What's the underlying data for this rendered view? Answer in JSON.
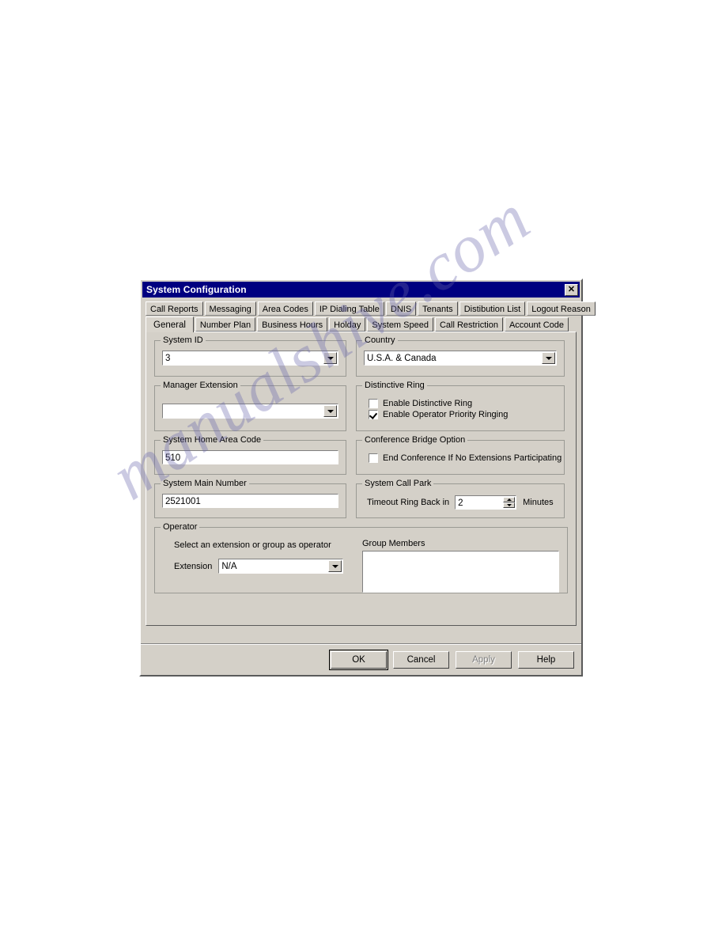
{
  "watermark": {
    "text": "manualshive.com"
  },
  "window": {
    "title": "System Configuration",
    "close_label": "✕"
  },
  "tabs": {
    "row1": [
      {
        "label": "Call Reports",
        "active": false
      },
      {
        "label": "Messaging",
        "active": false
      },
      {
        "label": "Area Codes",
        "active": false
      },
      {
        "label": "IP Dialing Table",
        "active": false
      },
      {
        "label": "DNIS",
        "active": false
      },
      {
        "label": "Tenants",
        "active": false
      },
      {
        "label": "Distibution List",
        "active": false
      },
      {
        "label": "Logout Reason",
        "active": false
      }
    ],
    "row2": [
      {
        "label": "General",
        "active": true
      },
      {
        "label": "Number Plan",
        "active": false
      },
      {
        "label": "Business Hours",
        "active": false
      },
      {
        "label": "Holday",
        "active": false
      },
      {
        "label": "System Speed",
        "active": false
      },
      {
        "label": "Call Restriction",
        "active": false
      },
      {
        "label": "Account Code",
        "active": false
      }
    ]
  },
  "form": {
    "system_id": {
      "legend": "System ID",
      "value": "3"
    },
    "manager_extension": {
      "legend": "Manager Extension",
      "value": ""
    },
    "system_home_area_code": {
      "legend": "System Home Area Code",
      "value": "510"
    },
    "system_main_number": {
      "legend": "System Main Number",
      "value": "2521001"
    },
    "country": {
      "legend": "Country",
      "value": "U.S.A. & Canada"
    },
    "distinctive_ring": {
      "legend": "Distinctive Ring",
      "items": [
        {
          "label": "Enable Distinctive Ring",
          "checked": false
        },
        {
          "label": "Enable Operator Priority Ringing",
          "checked": true
        }
      ]
    },
    "conference_bridge": {
      "legend": "Conference Bridge Option",
      "items": [
        {
          "label": "End Conference If No Extensions Participating",
          "checked": false
        }
      ]
    },
    "system_call_park": {
      "legend": "System Call Park",
      "timeout_label": "Timeout Ring Back in",
      "timeout_value": "2",
      "units_label": "Minutes"
    },
    "operator": {
      "legend": "Operator",
      "hint": "Select an extension or group as operator",
      "extension_label": "Extension",
      "extension_value": "N/A",
      "group_members_label": "Group Members",
      "group_members": []
    }
  },
  "footer": {
    "buttons": [
      {
        "label": "OK",
        "state": "default"
      },
      {
        "label": "Cancel",
        "state": "normal"
      },
      {
        "label": "Apply",
        "state": "disabled"
      },
      {
        "label": "Help",
        "state": "normal"
      }
    ]
  }
}
